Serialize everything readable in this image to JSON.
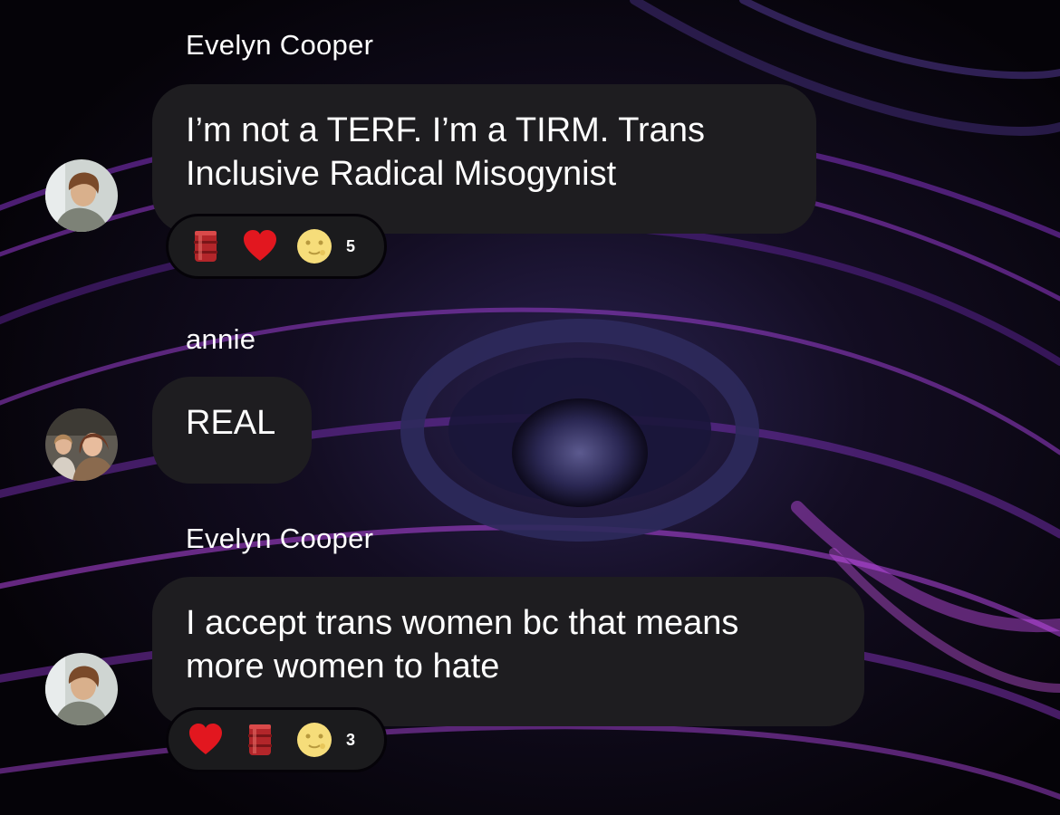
{
  "messages": [
    {
      "sender": "Evelyn Cooper",
      "avatar": "boy-portrait-avatar",
      "text": "I’m not a TERF.  I’m a TIRM. Trans\nInclusive Radical Misogynist",
      "reactions": [
        "oil-drum",
        "red-heart",
        "full-moon-face"
      ],
      "reaction_count": "5"
    },
    {
      "sender": "annie",
      "avatar": "two-girls-photo-avatar",
      "text": "REAL"
    },
    {
      "sender": "Evelyn Cooper",
      "avatar": "boy-portrait-avatar",
      "text": "I accept trans women bc that means\nmore women to hate",
      "reactions": [
        "red-heart",
        "oil-drum",
        "full-moon-face"
      ],
      "reaction_count": "3"
    }
  ],
  "colors": {
    "bubble": "#1e1d20",
    "text": "#ffffff",
    "wallpaper_accent": "#a32fd0"
  }
}
